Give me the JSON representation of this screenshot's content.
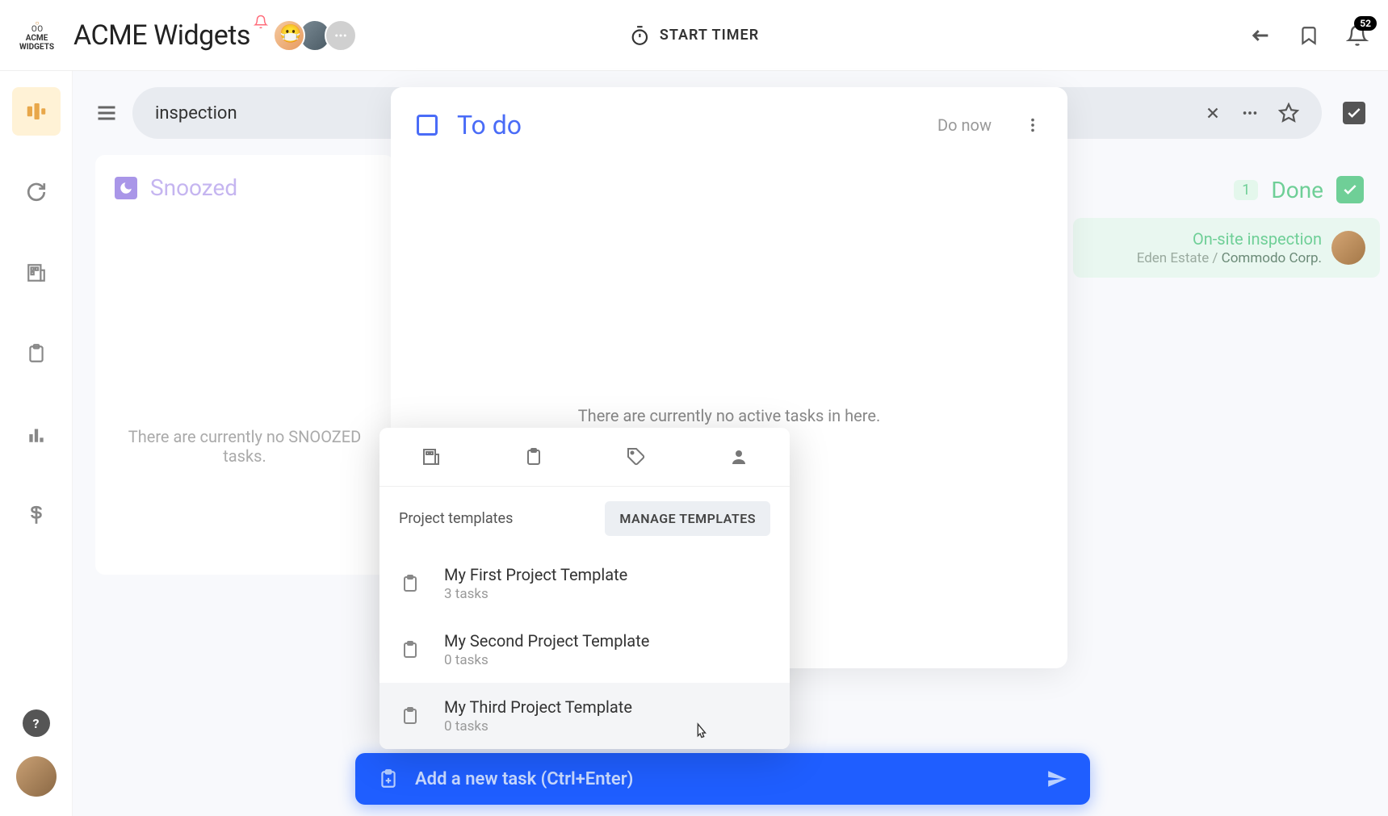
{
  "header": {
    "logo_text1": "ACME",
    "logo_text2": "WIDGETS",
    "title": "ACME Widgets",
    "start_timer": "START TIMER",
    "notif_count": "52"
  },
  "search": {
    "value": "inspection"
  },
  "columns": {
    "snoozed": {
      "label": "Snoozed",
      "empty": "There are currently no SNOOZED tasks."
    },
    "todo": {
      "label": "To do",
      "do_now": "Do now",
      "empty": "There are currently no active tasks in here."
    },
    "done": {
      "label": "Done",
      "count": "1",
      "task": {
        "title": "On-site inspection",
        "sub1": "Eden Estate /",
        "sub2": "Commodo Corp."
      }
    }
  },
  "popup": {
    "section_title": "Project templates",
    "manage": "MANAGE TEMPLATES",
    "items": [
      {
        "name": "My First Project Template",
        "sub": "3 tasks"
      },
      {
        "name": "My Second Project Template",
        "sub": "0 tasks"
      },
      {
        "name": "My Third Project Template",
        "sub": "0 tasks"
      }
    ]
  },
  "add_bar": {
    "text": "Add a new task (Ctrl+Enter)"
  }
}
